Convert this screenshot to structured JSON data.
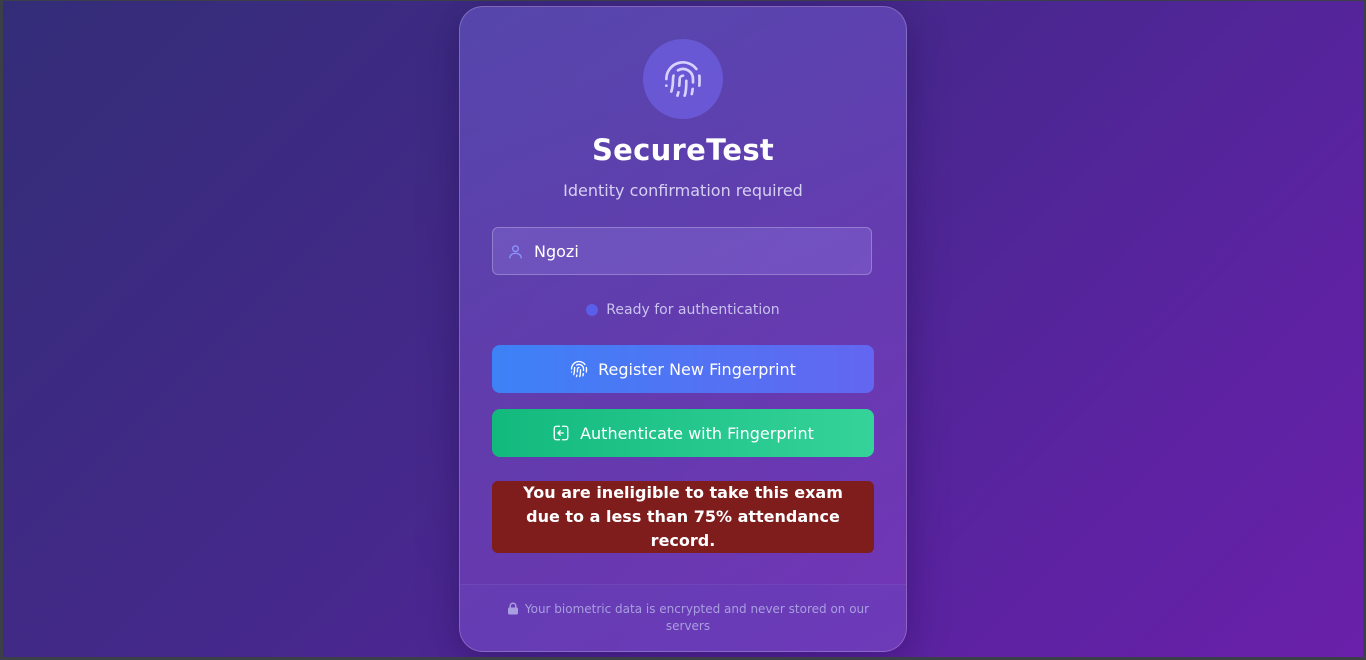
{
  "app": {
    "title": "SecureTest",
    "subtitle": "Identity confirmation required"
  },
  "logo": {
    "icon": "fingerprint-icon"
  },
  "username": {
    "value": "Ngozi",
    "icon": "user-icon"
  },
  "status": {
    "text": "Ready for authentication",
    "dot_color": "#5a5ee8"
  },
  "buttons": {
    "register_label": "Register New Fingerprint",
    "register_icon": "fingerprint-icon",
    "authenticate_label": "Authenticate with Fingerprint",
    "authenticate_icon": "login-icon"
  },
  "alert": {
    "message": "You are ineligible to take this exam due to a less than 75% attendance record."
  },
  "footer": {
    "text": "Your biometric data is encrypted and never stored on our servers",
    "icon": "lock-icon"
  },
  "colors": {
    "register_gradient": [
      "#3d82f6",
      "#6366f1"
    ],
    "authenticate_gradient": [
      "#12b97d",
      "#35d399"
    ],
    "alert_bg": "#7f1d1d"
  }
}
